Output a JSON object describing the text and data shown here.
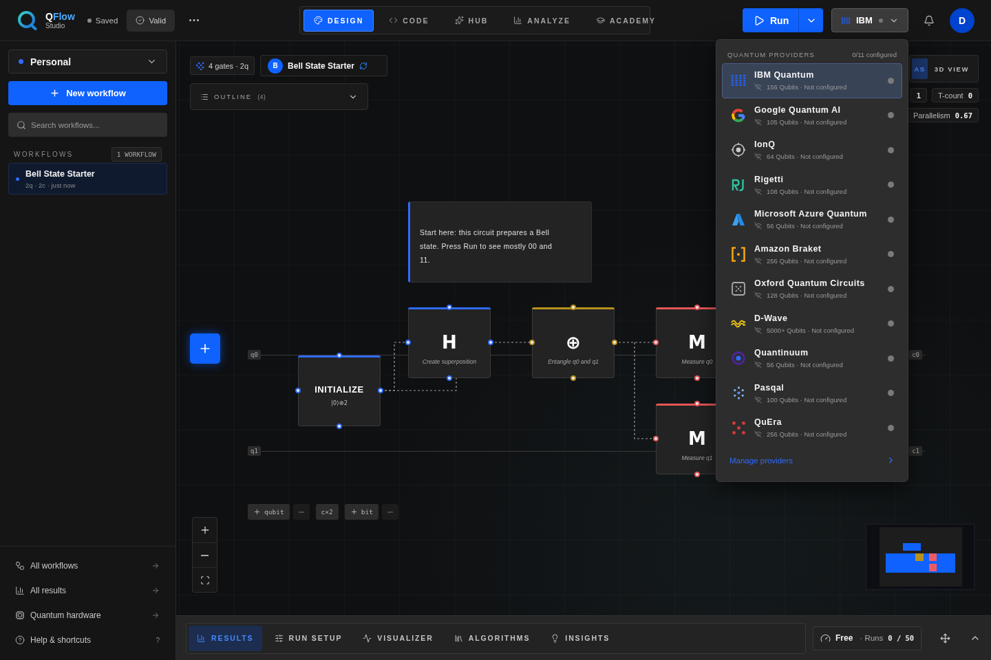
{
  "header": {
    "brand": {
      "name": [
        "Q",
        "Flow"
      ],
      "subtitle": "Studio"
    },
    "save_status": "Saved",
    "validity": {
      "label": "Valid"
    },
    "tabs": [
      {
        "label": "DESIGN",
        "selected": true
      },
      {
        "label": "CODE",
        "selected": false
      },
      {
        "label": "HUB",
        "selected": false
      },
      {
        "label": "ANALYZE",
        "selected": false
      },
      {
        "label": "ACADEMY",
        "selected": false
      }
    ],
    "run_button": {
      "label": "Run"
    },
    "provider_button": {
      "label": "IBM",
      "configured": false,
      "expanded": true
    },
    "avatar": {
      "initial": "D"
    }
  },
  "sidebar": {
    "workspace": {
      "label": "Personal"
    },
    "new_button": {
      "label": "New workflow"
    },
    "search": {
      "placeholder": "Search workflows..."
    },
    "section": {
      "label": "WORKFLOWS",
      "count": "1 WORKFLOW"
    },
    "workflows": [
      {
        "name": "Bell State Starter",
        "meta": "2q · 2c · just now",
        "selected": true
      }
    ],
    "links": [
      {
        "label": "All workflows"
      },
      {
        "label": "All results"
      },
      {
        "label": "Quantum hardware"
      },
      {
        "label": "Help & shortcuts",
        "shortcut": "?"
      }
    ]
  },
  "canvas": {
    "summary": "4 gates · 2q",
    "workflow": {
      "initial": "B",
      "title": "Bell State Starter"
    },
    "outline": {
      "label": "OUTLINE",
      "count": "(4)",
      "expanded": false
    },
    "view_tabs": [
      {
        "label": "AS",
        "selected": true
      },
      {
        "label": "3D VIEW",
        "selected": false
      }
    ],
    "stats": [
      {
        "value": "1"
      },
      {
        "label": "T-count",
        "value": "0"
      },
      {
        "label": "Parallelism",
        "value": "0.67"
      }
    ],
    "note": "Start here: this circuit prepares a Bell state. Press Run to see mostly 00 and 11.",
    "wires": [
      {
        "qubit": "q0",
        "classical": "c0"
      },
      {
        "qubit": "q1",
        "classical": "c1"
      }
    ],
    "nodes": [
      {
        "kind": "init",
        "title": "INITIALIZE",
        "caption": "|0⟩⊗2",
        "color": "#2f6bff"
      },
      {
        "kind": "gate",
        "title": "H",
        "caption": "Create superposition",
        "color": "#2f6bff"
      },
      {
        "kind": "gate",
        "title": "⊕",
        "caption": "Entangle q0 and q1",
        "color": "#b8911c"
      },
      {
        "kind": "gate",
        "title": "M",
        "caption": "Measure q0",
        "color": "#e85656"
      },
      {
        "kind": "gate",
        "title": "M",
        "caption": "Measure q1",
        "color": "#e85656"
      }
    ],
    "register_controls": [
      {
        "kind": "add",
        "label": "qubit"
      },
      {
        "kind": "remove"
      },
      {
        "kind": "count",
        "label": "c×2"
      },
      {
        "kind": "add",
        "label": "bit"
      },
      {
        "kind": "remove"
      }
    ]
  },
  "providers_menu": {
    "title": "QUANTUM PROVIDERS",
    "summary": "0/11 configured",
    "providers": [
      {
        "name": "IBM Quantum",
        "detail": "156 Qubits · Not configured",
        "configured": false,
        "selected": true
      },
      {
        "name": "Google Quantum AI",
        "detail": "105 Qubits · Not configured",
        "configured": false,
        "selected": false
      },
      {
        "name": "IonQ",
        "detail": "64 Qubits · Not configured",
        "configured": false,
        "selected": false
      },
      {
        "name": "Rigetti",
        "detail": "108 Qubits · Not configured",
        "configured": false,
        "selected": false
      },
      {
        "name": "Microsoft Azure Quantum",
        "detail": "56 Qubits · Not configured",
        "configured": false,
        "selected": false
      },
      {
        "name": "Amazon Braket",
        "detail": "256 Qubits · Not configured",
        "configured": false,
        "selected": false
      },
      {
        "name": "Oxford Quantum Circuits",
        "detail": "128 Qubits · Not configured",
        "configured": false,
        "selected": false
      },
      {
        "name": "D-Wave",
        "detail": "5000+ Qubits · Not configured",
        "configured": false,
        "selected": false
      },
      {
        "name": "Quantinuum",
        "detail": "56 Qubits · Not configured",
        "configured": false,
        "selected": false
      },
      {
        "name": "Pasqal",
        "detail": "100 Qubits · Not configured",
        "configured": false,
        "selected": false
      },
      {
        "name": "QuEra",
        "detail": "256 Qubits · Not configured",
        "configured": false,
        "selected": false
      }
    ],
    "footer": "Manage providers"
  },
  "bottom_panel": {
    "tabs": [
      {
        "label": "RESULTS",
        "selected": true
      },
      {
        "label": "RUN SETUP",
        "selected": false
      },
      {
        "label": "VISUALIZER",
        "selected": false
      },
      {
        "label": "ALGORITHMS",
        "selected": false
      },
      {
        "label": "INSIGHTS",
        "selected": false
      }
    ],
    "plan": {
      "tier": "Free",
      "runs_label": "· Runs",
      "runs": "0 / 50"
    },
    "expanded": false
  }
}
